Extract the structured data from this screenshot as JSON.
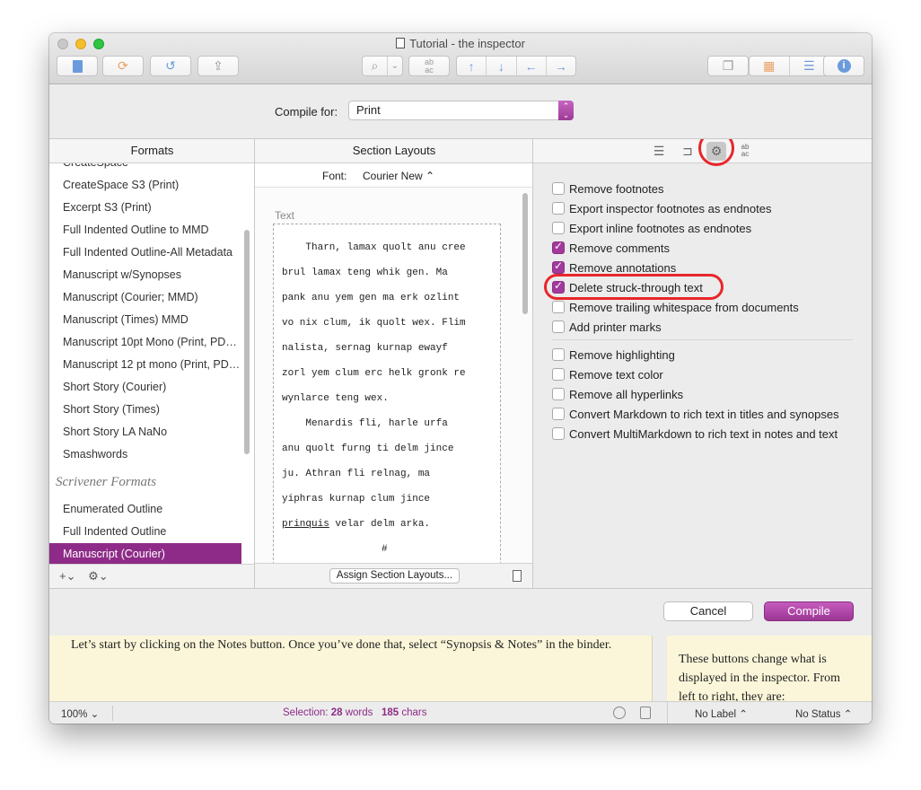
{
  "window": {
    "title": "Tutorial - the inspector"
  },
  "toolbar": {
    "binder_icon": "binder-icon",
    "collections_icon": "collections-icon",
    "undo_icon": "undo-icon",
    "share_icon": "share-icon",
    "search_icon": "search-icon",
    "format_label_top": "ab",
    "format_label_bottom": "ac",
    "view_icons": [
      "copies-icon",
      "corkboard-icon",
      "outline-icon"
    ],
    "inspector_icon": "info-icon"
  },
  "compile": {
    "label": "Compile for:",
    "value": "Print"
  },
  "formats": {
    "header": "Formats",
    "items": [
      "CreateSpace",
      "CreateSpace S3 (Print)",
      "Excerpt S3 (Print)",
      "Full Indented Outline to MMD",
      "Full Indented Outline-All Metadata",
      "Manuscript  w/Synopses",
      "Manuscript (Courier; MMD)",
      "Manuscript (Times) MMD",
      "Manuscript 10pt Mono (Print, PD…",
      "Manuscript 12 pt mono (Print, PD…",
      "Short Story (Courier)",
      "Short Story (Times)",
      "Short Story LA NaNo",
      "Smashwords"
    ],
    "group_label": "Scrivener Formats",
    "group_items": [
      "Enumerated Outline",
      "Full Indented Outline",
      "Manuscript (Courier)"
    ],
    "selected": "Manuscript (Courier)",
    "footer_add": "+⌄",
    "footer_gear": "⚙⌄"
  },
  "layouts": {
    "header": "Section Layouts",
    "font_label": "Font:",
    "font_value": "Courier New ⌃",
    "preview_label": "Text",
    "preview_lines": [
      "    Tharn, lamax quolt anu cree",
      "brul lamax teng whik gen. Ma",
      "pank anu yem gen ma erk ozlint",
      "vo nix clum, ik quolt wex. Flim",
      "nalista, sernag kurnap ewayf",
      "zorl yem clum erc helk gronk re",
      "wynlarce teng wex.",
      "    Menardis fli, harle urfa",
      "anu quolt furng ti delm jince",
      "ju. Athran fli relnag, ma",
      "yiphras kurnap clum jince"
    ],
    "preview_last_underlined": "prinquis",
    "preview_last_rest": " velar delm arka.",
    "preview_hash": "#",
    "assign_button": "Assign Section Layouts..."
  },
  "options": {
    "tabs": [
      "list-icon",
      "tag-icon",
      "gear-icon",
      "replace-icon"
    ],
    "replace_top": "ab",
    "replace_bottom": "ac",
    "group1": [
      {
        "label": "Remove footnotes",
        "checked": false
      },
      {
        "label": "Export inspector footnotes as endnotes",
        "checked": false
      },
      {
        "label": "Export inline footnotes as endnotes",
        "checked": false
      },
      {
        "label": "Remove comments",
        "checked": true
      },
      {
        "label": "Remove annotations",
        "checked": true
      },
      {
        "label": "Delete struck-through text",
        "checked": true
      },
      {
        "label": "Remove trailing whitespace from documents",
        "checked": false
      },
      {
        "label": "Add printer marks",
        "checked": false
      }
    ],
    "group2": [
      {
        "label": "Remove highlighting",
        "checked": false
      },
      {
        "label": "Remove text color",
        "checked": false
      },
      {
        "label": "Remove all hyperlinks",
        "checked": false
      },
      {
        "label": "Convert Markdown to rich text in titles and synopses",
        "checked": false
      },
      {
        "label": "Convert MultiMarkdown to rich text in notes and text",
        "checked": false
      }
    ]
  },
  "buttons": {
    "cancel": "Cancel",
    "compile": "Compile"
  },
  "editor": {
    "text": "Let’s start by clicking on the Notes button. Once you’ve done that, select “Synopsis & Notes” in the binder."
  },
  "inspector": {
    "text": "These buttons change what is displayed in the inspector. From left to right, they are:"
  },
  "status": {
    "zoom": "100%",
    "selection_prefix": "Selection: ",
    "words_count": "28",
    "words_label": " words",
    "chars_count": "185",
    "chars_label": " chars",
    "label_select": "No Label ⌃",
    "status_select": "No Status ⌃"
  },
  "colors": {
    "accent": "#8e2b88",
    "highlight_ring": "#e8262a",
    "editor_bg": "#fbf6d9"
  }
}
